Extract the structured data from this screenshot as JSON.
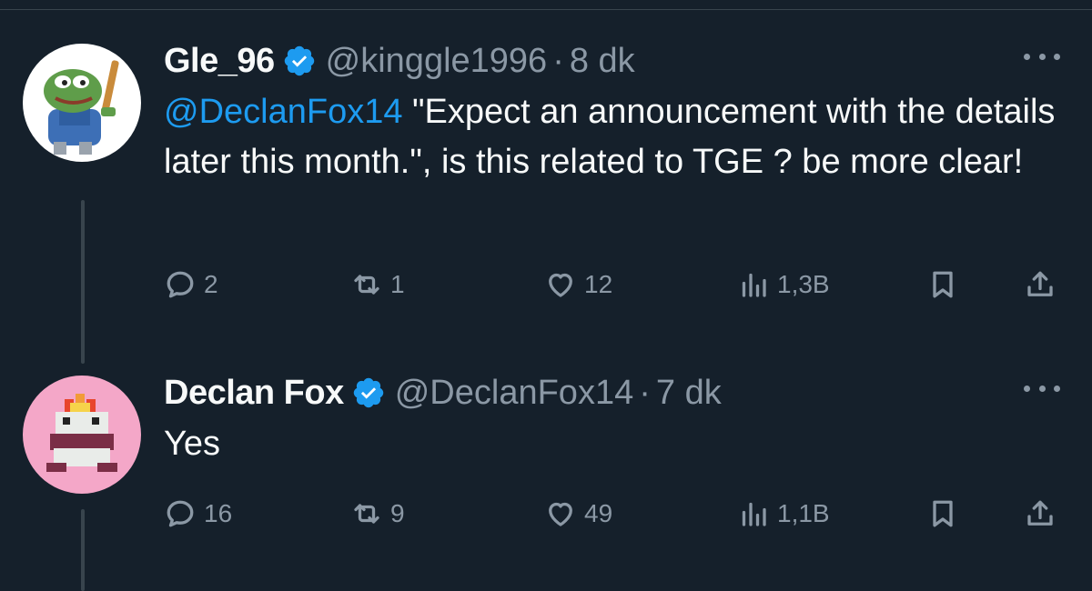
{
  "tweets": [
    {
      "display_name": "Gle_96",
      "handle": "@kinggle1996",
      "separator": "·",
      "time": "8 dk",
      "mention": "@DeclanFox14",
      "text": " \"Expect an announcement with the details later this month.\", is this related to TGE ? be more clear!",
      "replies": "2",
      "retweets": "1",
      "likes": "12",
      "views": "1,3B",
      "avatar_icon": "pepe-baseball-avatar"
    },
    {
      "display_name": "Declan Fox",
      "handle": "@DeclanFox14",
      "separator": "·",
      "time": "7 dk",
      "mention": "",
      "text": "Yes",
      "replies": "16",
      "retweets": "9",
      "likes": "49",
      "views": "1,1B",
      "avatar_icon": "pixel-toad-avatar"
    }
  ],
  "colors": {
    "background": "#15202b",
    "text": "#f7f9f9",
    "secondary": "#8b98a5",
    "accent": "#1d9bf0"
  }
}
